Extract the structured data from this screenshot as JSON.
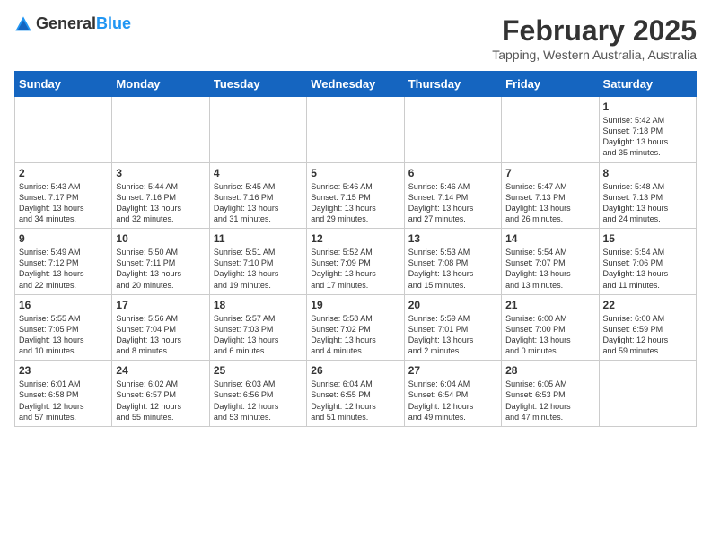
{
  "header": {
    "logo_general": "General",
    "logo_blue": "Blue",
    "title": "February 2025",
    "subtitle": "Tapping, Western Australia, Australia"
  },
  "calendar": {
    "weekdays": [
      "Sunday",
      "Monday",
      "Tuesday",
      "Wednesday",
      "Thursday",
      "Friday",
      "Saturday"
    ],
    "weeks": [
      [
        {
          "day": "",
          "info": ""
        },
        {
          "day": "",
          "info": ""
        },
        {
          "day": "",
          "info": ""
        },
        {
          "day": "",
          "info": ""
        },
        {
          "day": "",
          "info": ""
        },
        {
          "day": "",
          "info": ""
        },
        {
          "day": "1",
          "info": "Sunrise: 5:42 AM\nSunset: 7:18 PM\nDaylight: 13 hours\nand 35 minutes."
        }
      ],
      [
        {
          "day": "2",
          "info": "Sunrise: 5:43 AM\nSunset: 7:17 PM\nDaylight: 13 hours\nand 34 minutes."
        },
        {
          "day": "3",
          "info": "Sunrise: 5:44 AM\nSunset: 7:16 PM\nDaylight: 13 hours\nand 32 minutes."
        },
        {
          "day": "4",
          "info": "Sunrise: 5:45 AM\nSunset: 7:16 PM\nDaylight: 13 hours\nand 31 minutes."
        },
        {
          "day": "5",
          "info": "Sunrise: 5:46 AM\nSunset: 7:15 PM\nDaylight: 13 hours\nand 29 minutes."
        },
        {
          "day": "6",
          "info": "Sunrise: 5:46 AM\nSunset: 7:14 PM\nDaylight: 13 hours\nand 27 minutes."
        },
        {
          "day": "7",
          "info": "Sunrise: 5:47 AM\nSunset: 7:13 PM\nDaylight: 13 hours\nand 26 minutes."
        },
        {
          "day": "8",
          "info": "Sunrise: 5:48 AM\nSunset: 7:13 PM\nDaylight: 13 hours\nand 24 minutes."
        }
      ],
      [
        {
          "day": "9",
          "info": "Sunrise: 5:49 AM\nSunset: 7:12 PM\nDaylight: 13 hours\nand 22 minutes."
        },
        {
          "day": "10",
          "info": "Sunrise: 5:50 AM\nSunset: 7:11 PM\nDaylight: 13 hours\nand 20 minutes."
        },
        {
          "day": "11",
          "info": "Sunrise: 5:51 AM\nSunset: 7:10 PM\nDaylight: 13 hours\nand 19 minutes."
        },
        {
          "day": "12",
          "info": "Sunrise: 5:52 AM\nSunset: 7:09 PM\nDaylight: 13 hours\nand 17 minutes."
        },
        {
          "day": "13",
          "info": "Sunrise: 5:53 AM\nSunset: 7:08 PM\nDaylight: 13 hours\nand 15 minutes."
        },
        {
          "day": "14",
          "info": "Sunrise: 5:54 AM\nSunset: 7:07 PM\nDaylight: 13 hours\nand 13 minutes."
        },
        {
          "day": "15",
          "info": "Sunrise: 5:54 AM\nSunset: 7:06 PM\nDaylight: 13 hours\nand 11 minutes."
        }
      ],
      [
        {
          "day": "16",
          "info": "Sunrise: 5:55 AM\nSunset: 7:05 PM\nDaylight: 13 hours\nand 10 minutes."
        },
        {
          "day": "17",
          "info": "Sunrise: 5:56 AM\nSunset: 7:04 PM\nDaylight: 13 hours\nand 8 minutes."
        },
        {
          "day": "18",
          "info": "Sunrise: 5:57 AM\nSunset: 7:03 PM\nDaylight: 13 hours\nand 6 minutes."
        },
        {
          "day": "19",
          "info": "Sunrise: 5:58 AM\nSunset: 7:02 PM\nDaylight: 13 hours\nand 4 minutes."
        },
        {
          "day": "20",
          "info": "Sunrise: 5:59 AM\nSunset: 7:01 PM\nDaylight: 13 hours\nand 2 minutes."
        },
        {
          "day": "21",
          "info": "Sunrise: 6:00 AM\nSunset: 7:00 PM\nDaylight: 13 hours\nand 0 minutes."
        },
        {
          "day": "22",
          "info": "Sunrise: 6:00 AM\nSunset: 6:59 PM\nDaylight: 12 hours\nand 59 minutes."
        }
      ],
      [
        {
          "day": "23",
          "info": "Sunrise: 6:01 AM\nSunset: 6:58 PM\nDaylight: 12 hours\nand 57 minutes."
        },
        {
          "day": "24",
          "info": "Sunrise: 6:02 AM\nSunset: 6:57 PM\nDaylight: 12 hours\nand 55 minutes."
        },
        {
          "day": "25",
          "info": "Sunrise: 6:03 AM\nSunset: 6:56 PM\nDaylight: 12 hours\nand 53 minutes."
        },
        {
          "day": "26",
          "info": "Sunrise: 6:04 AM\nSunset: 6:55 PM\nDaylight: 12 hours\nand 51 minutes."
        },
        {
          "day": "27",
          "info": "Sunrise: 6:04 AM\nSunset: 6:54 PM\nDaylight: 12 hours\nand 49 minutes."
        },
        {
          "day": "28",
          "info": "Sunrise: 6:05 AM\nSunset: 6:53 PM\nDaylight: 12 hours\nand 47 minutes."
        },
        {
          "day": "",
          "info": ""
        }
      ]
    ]
  }
}
